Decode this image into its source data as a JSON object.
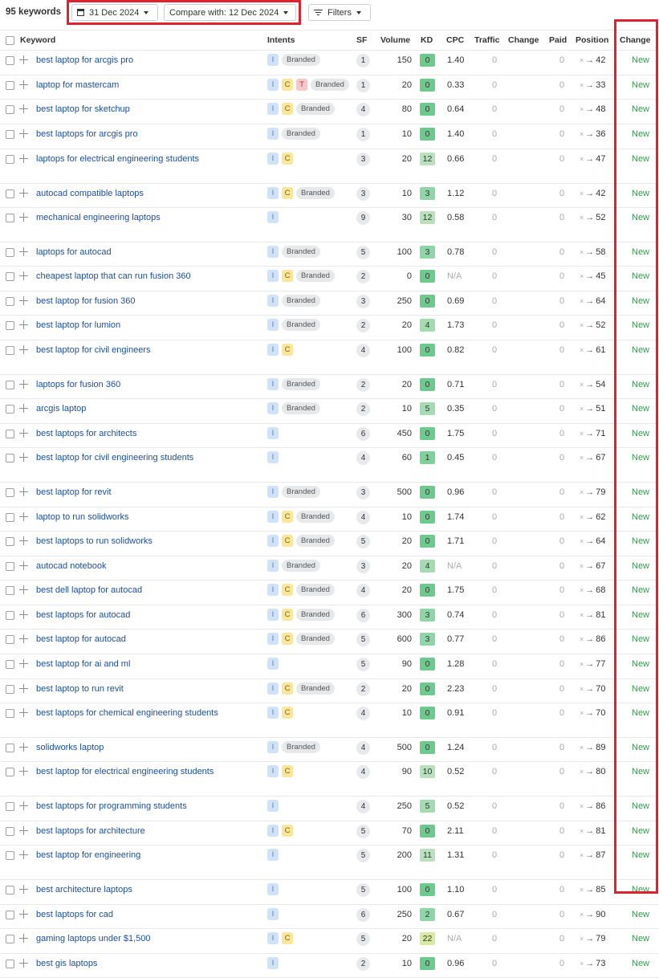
{
  "toolbar": {
    "keyword_count": "95 keywords",
    "date_label": "31 Dec 2024",
    "compare_label": "Compare with: 12 Dec 2024",
    "filters_label": "Filters"
  },
  "columns": {
    "keyword": "Keyword",
    "intents": "Intents",
    "sf": "SF",
    "volume": "Volume",
    "kd": "KD",
    "cpc": "CPC",
    "traffic": "Traffic",
    "change": "Change",
    "paid": "Paid",
    "position": "Position",
    "pos_change": "Change"
  },
  "colors": {
    "highlight": "#e0212e",
    "new": "#2b9d4a",
    "link": "#1a4e9a"
  },
  "rows": [
    {
      "keyword": "best laptop for arcgis pro",
      "intents": [
        "I",
        "Branded"
      ],
      "sf": "1",
      "volume": "150",
      "kd": "0",
      "cpc": "1.40",
      "traffic": "0",
      "paid": "0",
      "pos_from": "×",
      "pos_to": "42",
      "change": "New"
    },
    {
      "keyword": "laptop for mastercam",
      "intents": [
        "I",
        "C",
        "T",
        "Branded"
      ],
      "sf": "1",
      "volume": "20",
      "kd": "0",
      "cpc": "0.33",
      "traffic": "0",
      "paid": "0",
      "pos_from": "×",
      "pos_to": "33",
      "change": "New"
    },
    {
      "keyword": "best laptop for sketchup",
      "intents": [
        "I",
        "C",
        "Branded"
      ],
      "sf": "4",
      "volume": "80",
      "kd": "0",
      "cpc": "0.64",
      "traffic": "0",
      "paid": "0",
      "pos_from": "×",
      "pos_to": "48",
      "change": "New"
    },
    {
      "keyword": "best laptops for arcgis pro",
      "intents": [
        "I",
        "Branded"
      ],
      "sf": "1",
      "volume": "10",
      "kd": "0",
      "cpc": "1.40",
      "traffic": "0",
      "paid": "0",
      "pos_from": "×",
      "pos_to": "36",
      "change": "New"
    },
    {
      "keyword": "laptops for electrical engineering students",
      "intents": [
        "I",
        "C"
      ],
      "sf": "3",
      "volume": "20",
      "kd": "12",
      "cpc": "0.66",
      "traffic": "0",
      "paid": "0",
      "pos_from": "×",
      "pos_to": "47",
      "change": "New"
    },
    {
      "keyword": "autocad compatible laptops",
      "intents": [
        "I",
        "C",
        "Branded"
      ],
      "sf": "3",
      "volume": "10",
      "kd": "3",
      "cpc": "1.12",
      "traffic": "0",
      "paid": "0",
      "pos_from": "×",
      "pos_to": "42",
      "change": "New"
    },
    {
      "keyword": "mechanical engineering laptops",
      "intents": [
        "I"
      ],
      "sf": "9",
      "volume": "30",
      "kd": "12",
      "cpc": "0.58",
      "traffic": "0",
      "paid": "0",
      "pos_from": "×",
      "pos_to": "52",
      "change": "New"
    },
    {
      "keyword": "laptops for autocad",
      "intents": [
        "I",
        "Branded"
      ],
      "sf": "5",
      "volume": "100",
      "kd": "3",
      "cpc": "0.78",
      "traffic": "0",
      "paid": "0",
      "pos_from": "×",
      "pos_to": "58",
      "change": "New"
    },
    {
      "keyword": "cheapest laptop that can run fusion 360",
      "intents": [
        "I",
        "C",
        "Branded"
      ],
      "sf": "2",
      "volume": "0",
      "kd": "0",
      "cpc": "N/A",
      "traffic": "0",
      "paid": "0",
      "pos_from": "×",
      "pos_to": "45",
      "change": "New"
    },
    {
      "keyword": "best laptop for fusion 360",
      "intents": [
        "I",
        "Branded"
      ],
      "sf": "3",
      "volume": "250",
      "kd": "0",
      "cpc": "0.69",
      "traffic": "0",
      "paid": "0",
      "pos_from": "×",
      "pos_to": "64",
      "change": "New"
    },
    {
      "keyword": "best laptop for lumion",
      "intents": [
        "I",
        "Branded"
      ],
      "sf": "2",
      "volume": "20",
      "kd": "4",
      "cpc": "1.73",
      "traffic": "0",
      "paid": "0",
      "pos_from": "×",
      "pos_to": "52",
      "change": "New"
    },
    {
      "keyword": "best laptop for civil engineers",
      "intents": [
        "I",
        "C"
      ],
      "sf": "4",
      "volume": "100",
      "kd": "0",
      "cpc": "0.82",
      "traffic": "0",
      "paid": "0",
      "pos_from": "×",
      "pos_to": "61",
      "change": "New"
    },
    {
      "keyword": "laptops for fusion 360",
      "intents": [
        "I",
        "Branded"
      ],
      "sf": "2",
      "volume": "20",
      "kd": "0",
      "cpc": "0.71",
      "traffic": "0",
      "paid": "0",
      "pos_from": "×",
      "pos_to": "54",
      "change": "New"
    },
    {
      "keyword": "arcgis laptop",
      "intents": [
        "I",
        "Branded"
      ],
      "sf": "2",
      "volume": "10",
      "kd": "5",
      "cpc": "0.35",
      "traffic": "0",
      "paid": "0",
      "pos_from": "×",
      "pos_to": "51",
      "change": "New"
    },
    {
      "keyword": "best laptops for architects",
      "intents": [
        "I"
      ],
      "sf": "6",
      "volume": "450",
      "kd": "0",
      "cpc": "1.75",
      "traffic": "0",
      "paid": "0",
      "pos_from": "×",
      "pos_to": "71",
      "change": "New"
    },
    {
      "keyword": "best laptop for civil engineering students",
      "intents": [
        "I"
      ],
      "sf": "4",
      "volume": "60",
      "kd": "1",
      "cpc": "0.45",
      "traffic": "0",
      "paid": "0",
      "pos_from": "×",
      "pos_to": "67",
      "change": "New"
    },
    {
      "keyword": "best laptop for revit",
      "intents": [
        "I",
        "Branded"
      ],
      "sf": "3",
      "volume": "500",
      "kd": "0",
      "cpc": "0.96",
      "traffic": "0",
      "paid": "0",
      "pos_from": "×",
      "pos_to": "79",
      "change": "New"
    },
    {
      "keyword": "laptop to run solidworks",
      "intents": [
        "I",
        "C",
        "Branded"
      ],
      "sf": "4",
      "volume": "10",
      "kd": "0",
      "cpc": "1.74",
      "traffic": "0",
      "paid": "0",
      "pos_from": "×",
      "pos_to": "62",
      "change": "New"
    },
    {
      "keyword": "best laptops to run solidworks",
      "intents": [
        "I",
        "C",
        "Branded"
      ],
      "sf": "5",
      "volume": "20",
      "kd": "0",
      "cpc": "1.71",
      "traffic": "0",
      "paid": "0",
      "pos_from": "×",
      "pos_to": "64",
      "change": "New"
    },
    {
      "keyword": "autocad notebook",
      "intents": [
        "I",
        "Branded"
      ],
      "sf": "3",
      "volume": "20",
      "kd": "4",
      "cpc": "N/A",
      "traffic": "0",
      "paid": "0",
      "pos_from": "×",
      "pos_to": "67",
      "change": "New"
    },
    {
      "keyword": "best dell laptop for autocad",
      "intents": [
        "I",
        "C",
        "Branded"
      ],
      "sf": "4",
      "volume": "20",
      "kd": "0",
      "cpc": "1.75",
      "traffic": "0",
      "paid": "0",
      "pos_from": "×",
      "pos_to": "68",
      "change": "New"
    },
    {
      "keyword": "best laptops for autocad",
      "intents": [
        "I",
        "C",
        "Branded"
      ],
      "sf": "6",
      "volume": "300",
      "kd": "3",
      "cpc": "0.74",
      "traffic": "0",
      "paid": "0",
      "pos_from": "×",
      "pos_to": "81",
      "change": "New"
    },
    {
      "keyword": "best laptop for autocad",
      "intents": [
        "I",
        "C",
        "Branded"
      ],
      "sf": "5",
      "volume": "600",
      "kd": "3",
      "cpc": "0.77",
      "traffic": "0",
      "paid": "0",
      "pos_from": "×",
      "pos_to": "86",
      "change": "New"
    },
    {
      "keyword": "best laptop for ai and ml",
      "intents": [
        "I"
      ],
      "sf": "5",
      "volume": "90",
      "kd": "0",
      "cpc": "1.28",
      "traffic": "0",
      "paid": "0",
      "pos_from": "×",
      "pos_to": "77",
      "change": "New"
    },
    {
      "keyword": "best laptop to run revit",
      "intents": [
        "I",
        "C",
        "Branded"
      ],
      "sf": "2",
      "volume": "20",
      "kd": "0",
      "cpc": "2.23",
      "traffic": "0",
      "paid": "0",
      "pos_from": "×",
      "pos_to": "70",
      "change": "New"
    },
    {
      "keyword": "best laptops for chemical engineering students",
      "intents": [
        "I",
        "C"
      ],
      "sf": "4",
      "volume": "10",
      "kd": "0",
      "cpc": "0.91",
      "traffic": "0",
      "paid": "0",
      "pos_from": "×",
      "pos_to": "70",
      "change": "New"
    },
    {
      "keyword": "solidworks laptop",
      "intents": [
        "I",
        "Branded"
      ],
      "sf": "4",
      "volume": "500",
      "kd": "0",
      "cpc": "1.24",
      "traffic": "0",
      "paid": "0",
      "pos_from": "×",
      "pos_to": "89",
      "change": "New"
    },
    {
      "keyword": "best laptop for electrical engineering students",
      "intents": [
        "I",
        "C"
      ],
      "sf": "4",
      "volume": "90",
      "kd": "10",
      "cpc": "0.52",
      "traffic": "0",
      "paid": "0",
      "pos_from": "×",
      "pos_to": "80",
      "change": "New"
    },
    {
      "keyword": "best laptops for programming students",
      "intents": [
        "I"
      ],
      "sf": "4",
      "volume": "250",
      "kd": "5",
      "cpc": "0.52",
      "traffic": "0",
      "paid": "0",
      "pos_from": "×",
      "pos_to": "86",
      "change": "New"
    },
    {
      "keyword": "best laptops for architecture",
      "intents": [
        "I",
        "C"
      ],
      "sf": "5",
      "volume": "70",
      "kd": "0",
      "cpc": "2.11",
      "traffic": "0",
      "paid": "0",
      "pos_from": "×",
      "pos_to": "81",
      "change": "New"
    },
    {
      "keyword": "best laptop for engineering",
      "intents": [
        "I"
      ],
      "sf": "5",
      "volume": "200",
      "kd": "11",
      "cpc": "1.31",
      "traffic": "0",
      "paid": "0",
      "pos_from": "×",
      "pos_to": "87",
      "change": "New"
    },
    {
      "keyword": "best architecture laptops",
      "intents": [
        "I"
      ],
      "sf": "5",
      "volume": "100",
      "kd": "0",
      "cpc": "1.10",
      "traffic": "0",
      "paid": "0",
      "pos_from": "×",
      "pos_to": "85",
      "change": "New"
    },
    {
      "keyword": "best laptops for cad",
      "intents": [
        "I"
      ],
      "sf": "6",
      "volume": "250",
      "kd": "2",
      "cpc": "0.67",
      "traffic": "0",
      "paid": "0",
      "pos_from": "×",
      "pos_to": "90",
      "change": "New"
    },
    {
      "keyword": "gaming laptops under $1,500",
      "intents": [
        "I",
        "C"
      ],
      "sf": "5",
      "volume": "20",
      "kd": "22",
      "cpc": "N/A",
      "traffic": "0",
      "paid": "0",
      "pos_from": "×",
      "pos_to": "79",
      "change": "New"
    },
    {
      "keyword": "best gis laptops",
      "intents": [
        "I"
      ],
      "sf": "2",
      "volume": "10",
      "kd": "0",
      "cpc": "0.96",
      "traffic": "0",
      "paid": "0",
      "pos_from": "×",
      "pos_to": "73",
      "change": "New"
    }
  ]
}
